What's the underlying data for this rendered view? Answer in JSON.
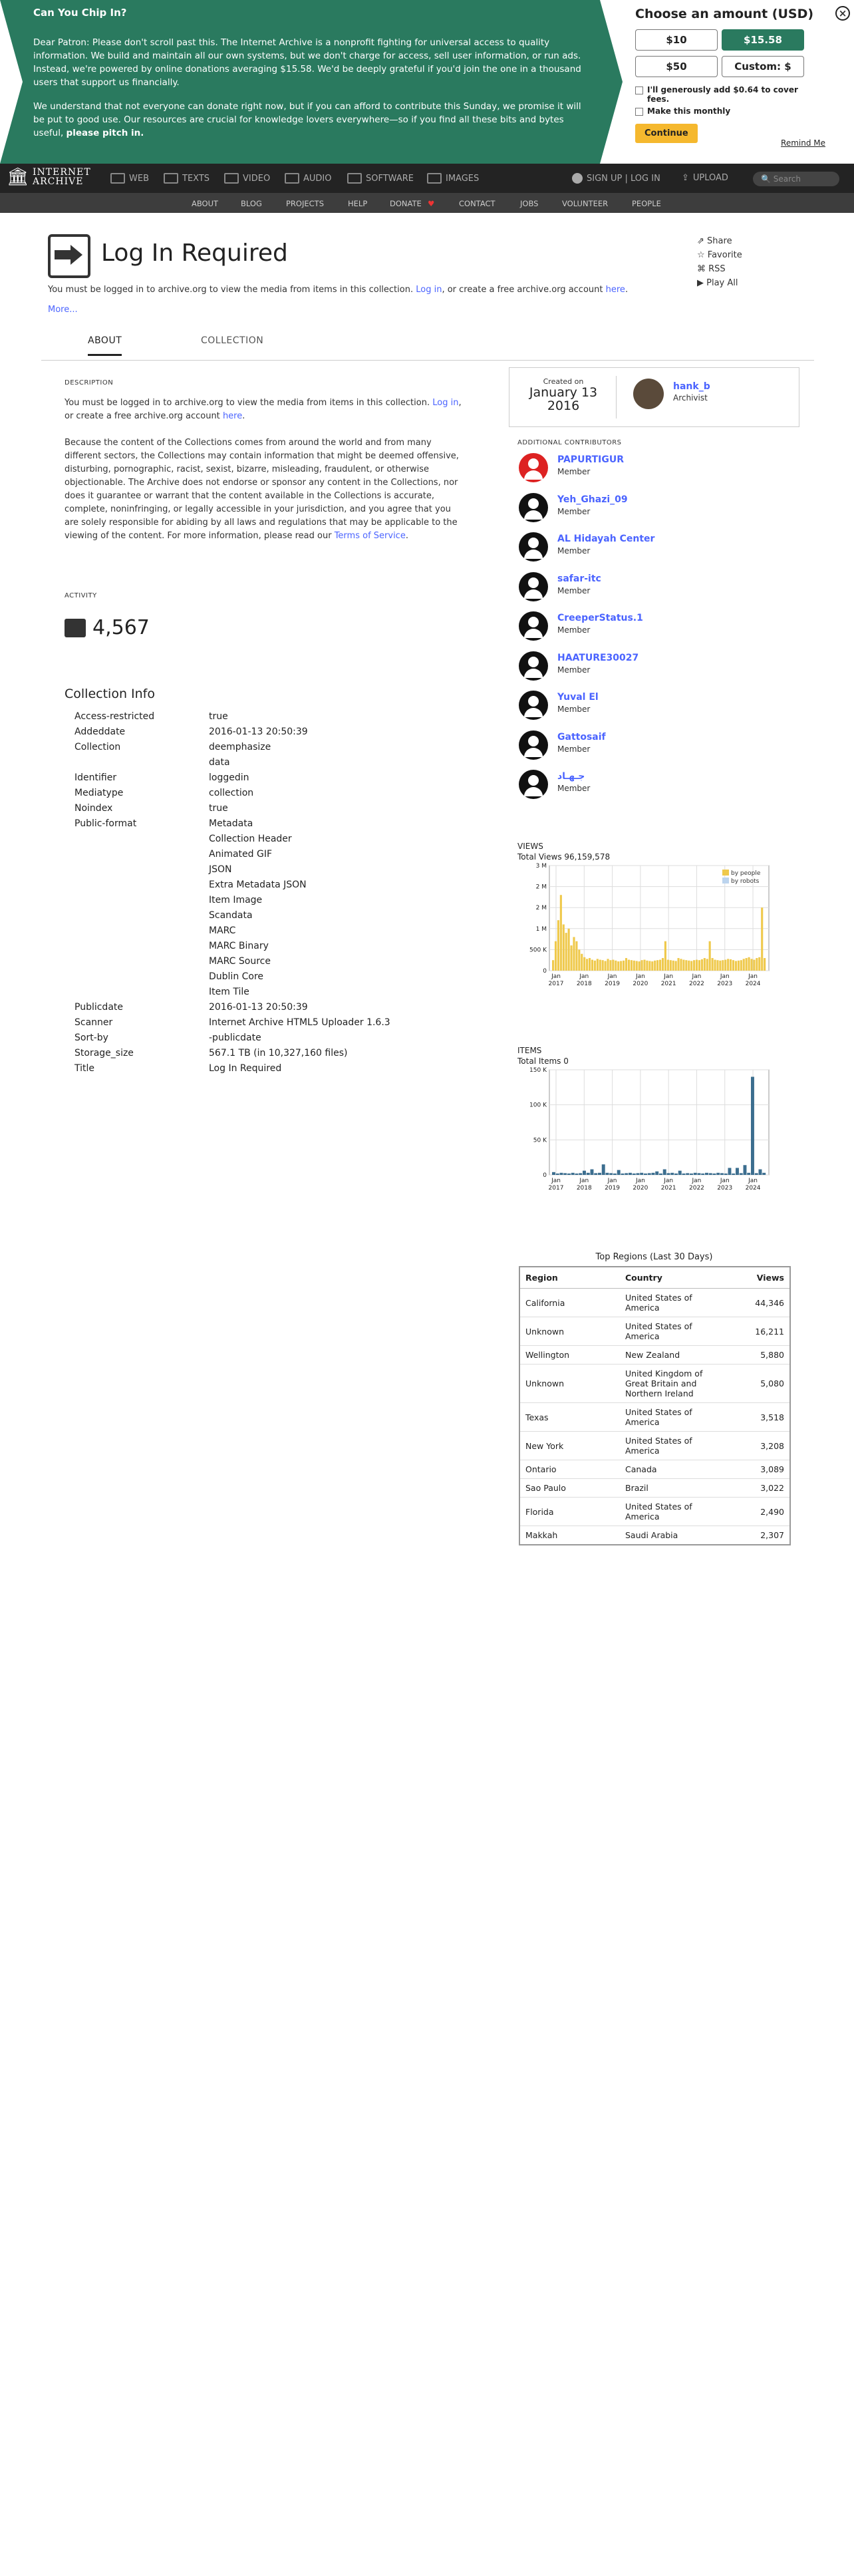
{
  "banner": {
    "title": "Can You Chip In?",
    "p1": "Dear Patron: Please don't scroll past this. The Internet Archive is a nonprofit fighting for universal access to quality information. We build and maintain all our own systems, but we don't charge for access, sell user information, or run ads. Instead, we're powered by online donations averaging $15.58. We'd be deeply grateful if you'd join the one in a thousand users that support us financially.",
    "p2": "We understand that not everyone can donate right now, but if you can afford to contribute this Sunday, we promise it will be put to good use. Our resources are crucial for knowledge lovers everywhere—so if you find all these bits and bytes useful,",
    "p2_bold": "please pitch in.",
    "choose": "Choose an amount (USD)",
    "amounts": [
      "$10",
      "$15.58",
      "$50",
      "Custom: $"
    ],
    "fee": "I'll generously add $0.64 to cover fees.",
    "monthly": "Make this monthly",
    "continue": "Continue",
    "remind": "Remind Me"
  },
  "nav": {
    "logo_line1": "INTERNET",
    "logo_line2": "ARCHIVE",
    "items": [
      "WEB",
      "TEXTS",
      "VIDEO",
      "AUDIO",
      "SOFTWARE",
      "IMAGES"
    ],
    "signin": "SIGN UP | LOG IN",
    "upload": "UPLOAD",
    "search_placeholder": "Search"
  },
  "subnav": [
    "ABOUT",
    "BLOG",
    "PROJECTS",
    "HELP",
    "DONATE",
    "CONTACT",
    "JOBS",
    "VOLUNTEER",
    "PEOPLE"
  ],
  "page": {
    "title": "Log In Required",
    "lead_a": "You must be logged in to archive.org to view the media from items in this collection.",
    "lead_login": "Log in",
    "lead_b": ", or create a free archive.org account",
    "lead_here": "here",
    "more": "More...",
    "actions": [
      "Share",
      "Favorite",
      "RSS",
      "Play All"
    ]
  },
  "tabs": [
    "ABOUT",
    "COLLECTION"
  ],
  "description": {
    "header": "DESCRIPTION",
    "p1_a": "You must be logged in to archive.org to view the media from items in this collection.",
    "p1_login": "Log in",
    "p1_b": ", or create a free archive.org account",
    "p1_here": "here",
    "p2": "Because the content of the Collections comes from around the world and from many different sectors, the Collections may contain information that might be deemed offensive, disturbing, pornographic, racist, sexist, bizarre, misleading, fraudulent, or otherwise objectionable. The Archive does not endorse or sponsor any content in the Collections, nor does it guarantee or warrant that the content available in the Collections is accurate, complete, noninfringing, or legally accessible in your jurisdiction, and you agree that you are solely responsible for abiding by all laws and regulations that may be applicable to the viewing of the content.  For more information, please read our",
    "p2_link": "Terms of Service"
  },
  "activity": {
    "header": "ACTIVITY",
    "count": "4,567"
  },
  "collection_info": {
    "title": "Collection Info",
    "rows": [
      {
        "k": "Access-restricted",
        "v": [
          "true"
        ]
      },
      {
        "k": "Addeddate",
        "v": [
          "2016-01-13 20:50:39"
        ]
      },
      {
        "k": "Collection",
        "v": [
          "deemphasize",
          "data"
        ]
      },
      {
        "k": "Identifier",
        "v": [
          "loggedin"
        ]
      },
      {
        "k": "Mediatype",
        "v": [
          "collection"
        ]
      },
      {
        "k": "Noindex",
        "v": [
          "true"
        ]
      },
      {
        "k": "Public-format",
        "v": [
          "Metadata",
          "Collection Header",
          "Animated GIF",
          "JSON",
          "Extra Metadata JSON",
          "Item Image",
          "Scandata",
          "MARC",
          "MARC Binary",
          "MARC Source",
          "Dublin Core",
          "Item Tile"
        ]
      },
      {
        "k": "Publicdate",
        "v": [
          "2016-01-13 20:50:39"
        ]
      },
      {
        "k": "Scanner",
        "v": [
          "Internet Archive HTML5 Uploader 1.6.3"
        ]
      },
      {
        "k": "Sort-by",
        "v": [
          "-publicdate"
        ]
      },
      {
        "k": "Storage_size",
        "v": [
          "567.1 TB (in 10,327,160 files)"
        ]
      },
      {
        "k": "Title",
        "v": [
          "Log In Required"
        ]
      }
    ]
  },
  "creator": {
    "created_on": "Created on",
    "date": "January 13",
    "year": "2016",
    "name": "hank_b",
    "role": "Archivist"
  },
  "contributors": {
    "header": "ADDITIONAL CONTRIBUTORS",
    "list": [
      {
        "name": "PAPURTIGUR",
        "role": "Member"
      },
      {
        "name": "Yeh_Ghazi_09",
        "role": "Member"
      },
      {
        "name": "AL Hidayah Center",
        "role": "Member"
      },
      {
        "name": "safar-itc",
        "role": "Member"
      },
      {
        "name": "CreeperStatus.1",
        "role": "Member"
      },
      {
        "name": "HAATURE30027",
        "role": "Member"
      },
      {
        "name": "Yuval El",
        "role": "Member"
      },
      {
        "name": "Gattosaif",
        "role": "Member"
      },
      {
        "name": "جـهـاد",
        "role": "Member"
      }
    ]
  },
  "views": {
    "title": "VIEWS",
    "total": "Total Views 96,159,578",
    "legend": [
      "by people",
      "by robots"
    ]
  },
  "items": {
    "title": "ITEMS",
    "total": "Total Items 0"
  },
  "chart_data": [
    {
      "type": "bar",
      "title": "VIEWS",
      "x": [
        "Jan 2017",
        "Jan 2018",
        "Jan 2019",
        "Jan 2020",
        "Jan 2021",
        "Jan 2022",
        "Jan 2023",
        "Jan 2024"
      ],
      "yticks": [
        "0",
        "500 K",
        "1 M",
        "2 M",
        "2 M",
        "3 M"
      ],
      "ylim": [
        0,
        2500000
      ],
      "series": [
        {
          "name": "by people",
          "color": "#efc94c",
          "values": [
            250000,
            700000,
            1200000,
            1800000,
            1100000,
            900000,
            1000000,
            600000,
            800000,
            700000,
            500000,
            400000,
            320000,
            280000,
            300000,
            260000,
            240000,
            280000,
            260000,
            250000,
            230000,
            280000,
            250000,
            260000,
            240000,
            220000,
            230000,
            240000,
            300000,
            260000,
            250000,
            240000,
            230000,
            220000,
            250000,
            260000,
            240000,
            230000,
            220000,
            240000,
            250000,
            260000,
            300000,
            700000,
            260000,
            250000,
            240000,
            230000,
            300000,
            280000,
            260000,
            250000,
            240000,
            230000,
            250000,
            260000,
            250000,
            270000,
            300000,
            280000,
            700000,
            300000,
            260000,
            250000,
            240000,
            250000,
            260000,
            280000,
            270000,
            250000,
            230000,
            240000,
            250000,
            280000,
            300000,
            320000,
            280000,
            260000,
            300000,
            320000,
            1500000,
            300000
          ]
        },
        {
          "name": "by robots",
          "color": "#bcd4ee",
          "values": []
        }
      ]
    },
    {
      "type": "bar",
      "title": "ITEMS",
      "x": [
        "Jan 2017",
        "Jan 2018",
        "Jan 2019",
        "Jan 2020",
        "Jan 2021",
        "Jan 2022",
        "Jan 2023",
        "Jan 2024"
      ],
      "yticks": [
        "0",
        "50 K",
        "100 K",
        "150 K"
      ],
      "ylim": [
        0,
        150000
      ],
      "series": [
        {
          "name": "items",
          "color": "#3c6e8f",
          "values": [
            4000,
            2000,
            3000,
            2500,
            2000,
            3000,
            2000,
            2500,
            6000,
            3000,
            8000,
            2500,
            3000,
            15000,
            3000,
            2500,
            2000,
            7000,
            2000,
            2500,
            3000,
            2000,
            2500,
            3000,
            2000,
            2500,
            3000,
            5000,
            2000,
            8000,
            2500,
            3000,
            2000,
            6000,
            2000,
            2500,
            2000,
            3000,
            2500,
            2000,
            3000,
            2500,
            2000,
            3000,
            2500,
            2000,
            10000,
            2000,
            10000,
            2500,
            14000,
            3000,
            140000,
            2500,
            8000,
            3000
          ]
        }
      ]
    }
  ],
  "regions": {
    "title": "Top Regions (Last 30 Days)",
    "headers": [
      "Region",
      "Country",
      "Views"
    ],
    "rows": [
      [
        "California",
        "United States of America",
        "44,346"
      ],
      [
        "Unknown",
        "United States of America",
        "16,211"
      ],
      [
        "Wellington",
        "New Zealand",
        "5,880"
      ],
      [
        "Unknown",
        "United Kingdom of Great Britain and Northern Ireland",
        "5,080"
      ],
      [
        "Texas",
        "United States of America",
        "3,518"
      ],
      [
        "New York",
        "United States of America",
        "3,208"
      ],
      [
        "Ontario",
        "Canada",
        "3,089"
      ],
      [
        "Sao Paulo",
        "Brazil",
        "3,022"
      ],
      [
        "Florida",
        "United States of America",
        "2,490"
      ],
      [
        "Makkah",
        "Saudi Arabia",
        "2,307"
      ]
    ]
  }
}
